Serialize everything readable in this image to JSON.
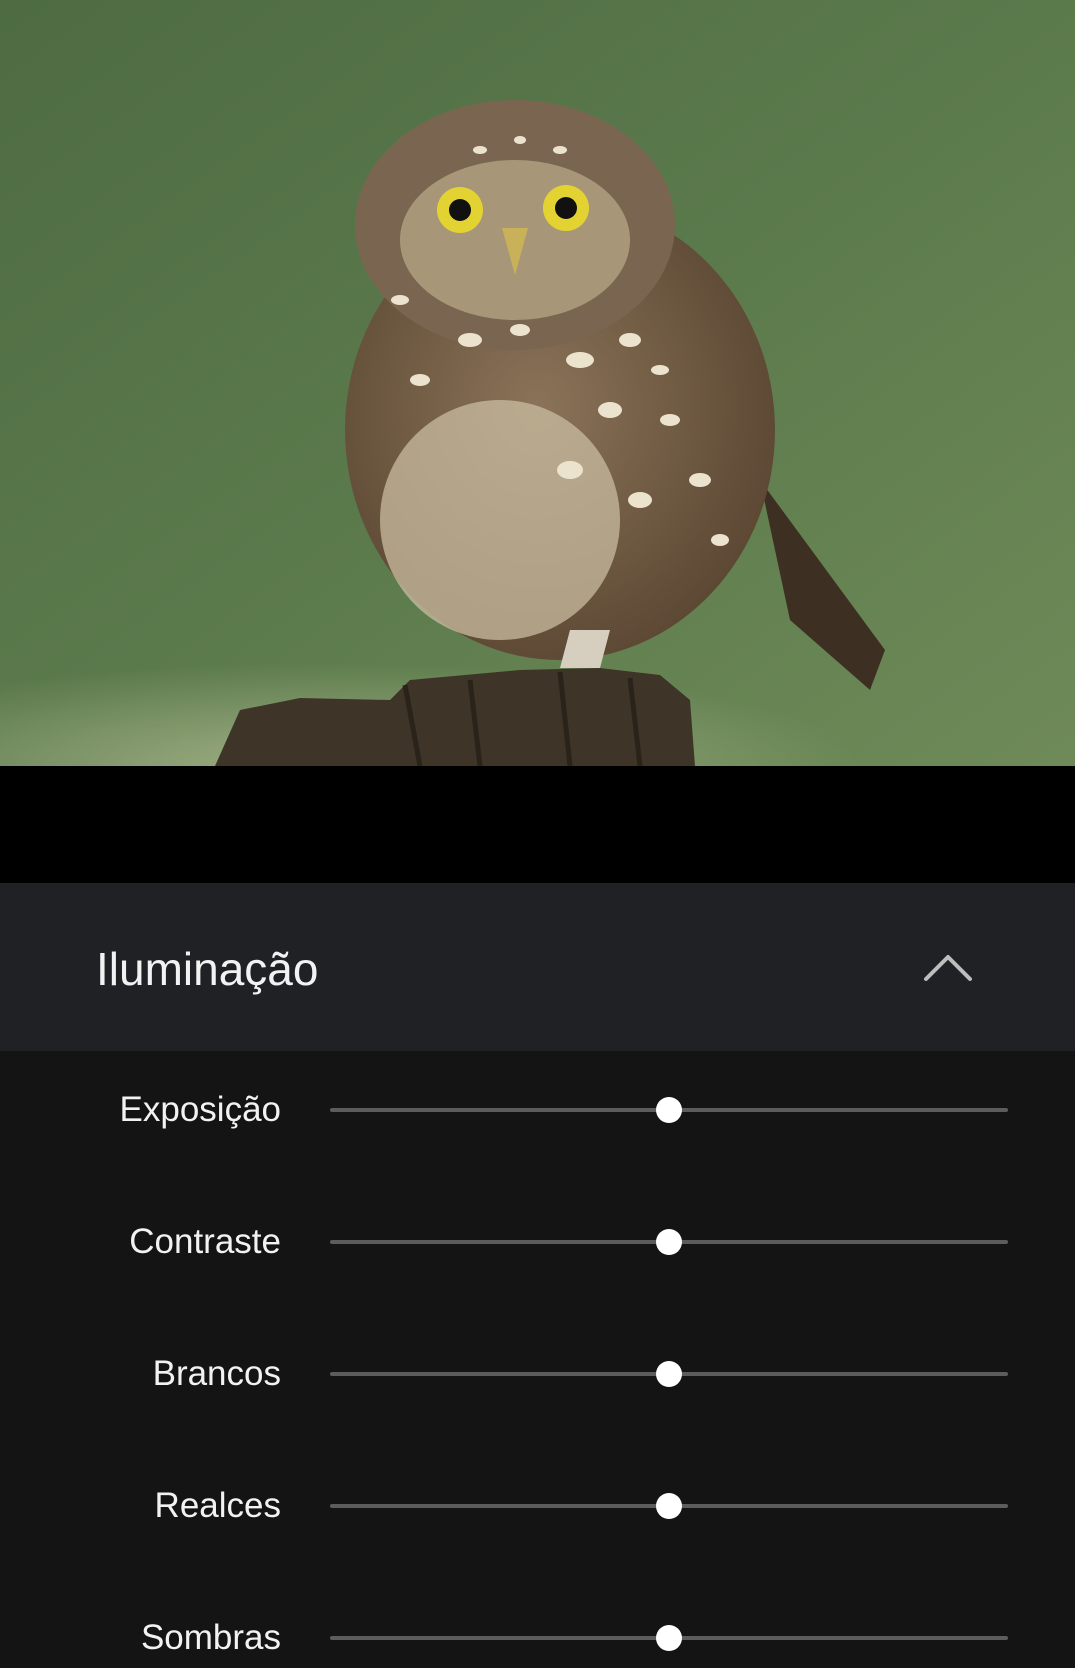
{
  "photo": {
    "subject": "owl-photo",
    "background_color": "#5b7a4c"
  },
  "section": {
    "title": "Iluminação",
    "collapse_icon": "chevron-up-icon",
    "expanded": true
  },
  "sliders": [
    {
      "id": "exposure",
      "label": "Exposição",
      "value": 0.5
    },
    {
      "id": "contrast",
      "label": "Contraste",
      "value": 0.5
    },
    {
      "id": "whites",
      "label": "Brancos",
      "value": 0.5
    },
    {
      "id": "highlights",
      "label": "Realces",
      "value": 0.5
    },
    {
      "id": "shadows",
      "label": "Sombras",
      "value": 0.5
    }
  ],
  "colors": {
    "panel_header_bg": "#202124",
    "panel_bg": "#141414",
    "track": "#5c5c5f",
    "thumb": "#ffffff",
    "text": "#f2f2f2"
  }
}
